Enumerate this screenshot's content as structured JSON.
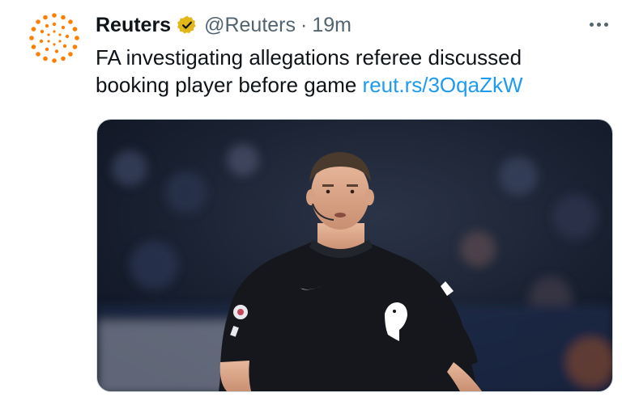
{
  "tweet": {
    "author_name": "Reuters",
    "handle": "@Reuters",
    "separator": "·",
    "time": "19m",
    "text_line1": "FA investigating allegations referee discussed",
    "text_line2": "booking player before game ",
    "link_text": "reut.rs/3OqaZkW"
  },
  "colors": {
    "reuters_orange": "#ff8000",
    "verified_gold": "#e2b719",
    "link_blue": "#1d9bf0",
    "kit_black": "#15171c"
  },
  "icons": {
    "avatar": "reuters-logo-icon",
    "badge": "verified-badge-icon",
    "more": "more-options-icon"
  }
}
